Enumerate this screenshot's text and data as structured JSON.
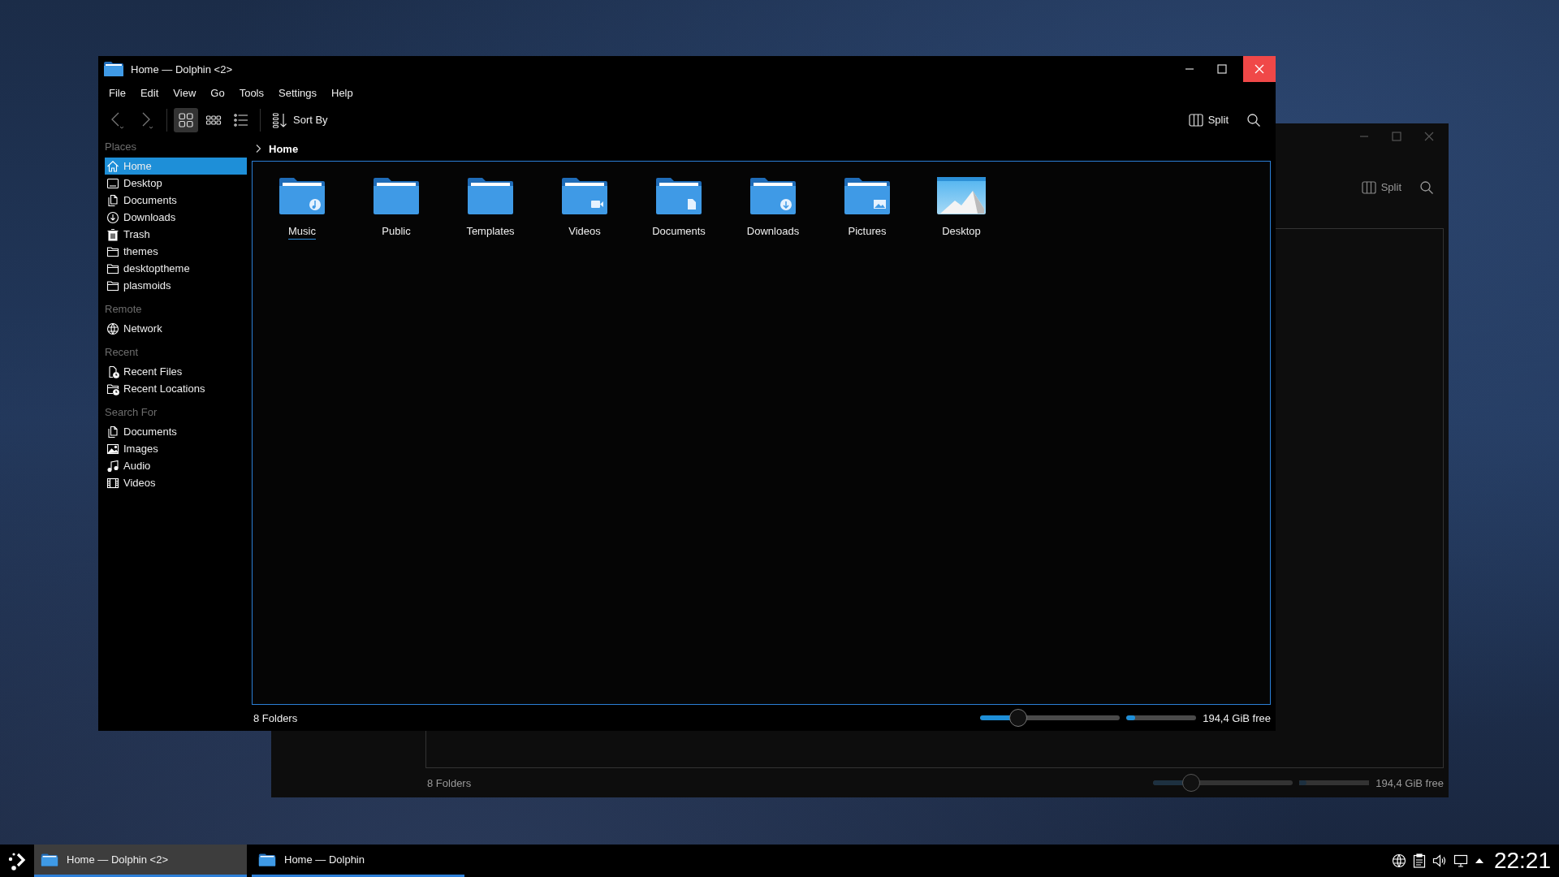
{
  "main_window": {
    "title": "Home — Dolphin <2>",
    "menu": [
      "File",
      "Edit",
      "View",
      "Go",
      "Tools",
      "Settings",
      "Help"
    ],
    "view_modes": [
      {
        "kind": "icons",
        "selected": true
      },
      {
        "kind": "compact",
        "selected": false
      },
      {
        "kind": "details",
        "selected": false
      }
    ],
    "sort_label": "Sort By",
    "split_label": "Split",
    "breadcrumb": "Home",
    "sidebar": [
      {
        "header": "Places",
        "items": [
          {
            "label": "Home",
            "kind": "home",
            "selected": true
          },
          {
            "label": "Desktop",
            "kind": "desktop",
            "selected": false
          },
          {
            "label": "Documents",
            "kind": "document",
            "selected": false
          },
          {
            "label": "Downloads",
            "kind": "download",
            "selected": false
          },
          {
            "label": "Trash",
            "kind": "trash",
            "selected": false
          },
          {
            "label": "themes",
            "kind": "folder",
            "selected": false
          },
          {
            "label": "desktoptheme",
            "kind": "folder",
            "selected": false
          },
          {
            "label": "plasmoids",
            "kind": "folder",
            "selected": false
          }
        ]
      },
      {
        "header": "Remote",
        "items": [
          {
            "label": "Network",
            "kind": "network",
            "selected": false
          }
        ]
      },
      {
        "header": "Recent",
        "items": [
          {
            "label": "Recent Files",
            "kind": "recent-file",
            "selected": false
          },
          {
            "label": "Recent Locations",
            "kind": "recent-folder",
            "selected": false
          }
        ]
      },
      {
        "header": "Search For",
        "items": [
          {
            "label": "Documents",
            "kind": "document",
            "selected": false
          },
          {
            "label": "Images",
            "kind": "image",
            "selected": false
          },
          {
            "label": "Audio",
            "kind": "audio",
            "selected": false
          },
          {
            "label": "Videos",
            "kind": "video",
            "selected": false
          }
        ]
      }
    ],
    "folders": [
      {
        "name": "Music",
        "kind": "music",
        "focused": true
      },
      {
        "name": "Public",
        "kind": "plain",
        "focused": false
      },
      {
        "name": "Templates",
        "kind": "plain",
        "focused": false
      },
      {
        "name": "Videos",
        "kind": "video",
        "focused": false
      },
      {
        "name": "Documents",
        "kind": "document",
        "focused": false
      },
      {
        "name": "Downloads",
        "kind": "download",
        "focused": false
      },
      {
        "name": "Pictures",
        "kind": "picture",
        "focused": false
      },
      {
        "name": "Desktop",
        "kind": "desktop",
        "focused": false
      }
    ],
    "status_text": "8 Folders",
    "zoom_slider": {
      "level": 0.27
    },
    "free_space": {
      "level": 0.13,
      "text": "194,4 GiB free"
    }
  },
  "background_window": {
    "split_label": "Split",
    "status_text": "8 Folders",
    "zoom_slider": {
      "level": 0.27
    },
    "free_space": {
      "level": 0.1,
      "text": "194,4 GiB free"
    }
  },
  "taskbar": {
    "tasks": [
      {
        "title": "Home — Dolphin <2>",
        "selected": true
      },
      {
        "title": "Home — Dolphin",
        "selected": false
      }
    ],
    "clock": "22:21"
  }
}
